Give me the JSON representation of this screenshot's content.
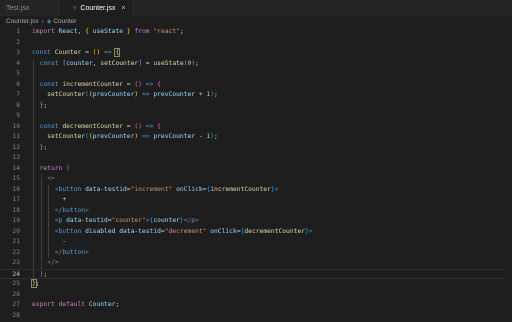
{
  "tabs": [
    {
      "label": "Test.jsx",
      "active": false
    },
    {
      "label": "Counter.jsx",
      "active": true
    }
  ],
  "breadcrumb": {
    "file": "Counter.jsx",
    "symbol": "Counter"
  },
  "current_line": 24,
  "code_lines": [
    [
      {
        "t": "import ",
        "c": "ctl"
      },
      {
        "t": "React",
        "c": "var"
      },
      {
        "t": ", ",
        "c": "plain"
      },
      {
        "t": "{",
        "c": "br1"
      },
      {
        "t": " useState ",
        "c": "var"
      },
      {
        "t": "}",
        "c": "br1"
      },
      {
        "t": " from ",
        "c": "ctl"
      },
      {
        "t": "\"react\"",
        "c": "str"
      },
      {
        "t": ";",
        "c": "plain"
      }
    ],
    [],
    [
      {
        "t": "const ",
        "c": "kw"
      },
      {
        "t": "Counter",
        "c": "fn"
      },
      {
        "t": " = ",
        "c": "op"
      },
      {
        "t": "()",
        "c": "br1"
      },
      {
        "t": " => ",
        "c": "kw"
      },
      {
        "t": "{",
        "c": "br1",
        "m": true
      }
    ],
    [
      {
        "t": "  const ",
        "c": "kw"
      },
      {
        "t": "[",
        "c": "br2"
      },
      {
        "t": "counter",
        "c": "var"
      },
      {
        "t": ", ",
        "c": "plain"
      },
      {
        "t": "setCounter",
        "c": "fn"
      },
      {
        "t": "]",
        "c": "br2"
      },
      {
        "t": " = ",
        "c": "op"
      },
      {
        "t": "useState",
        "c": "fn"
      },
      {
        "t": "(",
        "c": "br2"
      },
      {
        "t": "0",
        "c": "num"
      },
      {
        "t": ")",
        "c": "br2"
      },
      {
        "t": ";",
        "c": "plain"
      }
    ],
    [],
    [
      {
        "t": "  const ",
        "c": "kw"
      },
      {
        "t": "incrementCounter",
        "c": "fn"
      },
      {
        "t": " = ",
        "c": "op"
      },
      {
        "t": "()",
        "c": "br2"
      },
      {
        "t": " => ",
        "c": "kw"
      },
      {
        "t": "{",
        "c": "br2"
      }
    ],
    [
      {
        "t": "    setCounter",
        "c": "fn"
      },
      {
        "t": "(",
        "c": "br3"
      },
      {
        "t": "(",
        "c": "br1"
      },
      {
        "t": "prevCounter",
        "c": "var"
      },
      {
        "t": ")",
        "c": "br1"
      },
      {
        "t": " => ",
        "c": "kw"
      },
      {
        "t": "prevCounter",
        "c": "var"
      },
      {
        "t": " + ",
        "c": "op"
      },
      {
        "t": "1",
        "c": "num"
      },
      {
        "t": ")",
        "c": "br3"
      },
      {
        "t": ";",
        "c": "plain"
      }
    ],
    [
      {
        "t": "  ",
        "c": "plain"
      },
      {
        "t": "}",
        "c": "br2"
      },
      {
        "t": ";",
        "c": "plain"
      }
    ],
    [],
    [
      {
        "t": "  const ",
        "c": "kw"
      },
      {
        "t": "decrementCounter",
        "c": "fn"
      },
      {
        "t": " = ",
        "c": "op"
      },
      {
        "t": "()",
        "c": "br2"
      },
      {
        "t": " => ",
        "c": "kw"
      },
      {
        "t": "{",
        "c": "br2"
      }
    ],
    [
      {
        "t": "    setCounter",
        "c": "fn"
      },
      {
        "t": "(",
        "c": "br3"
      },
      {
        "t": "(",
        "c": "br1"
      },
      {
        "t": "prevCounter",
        "c": "var"
      },
      {
        "t": ")",
        "c": "br1"
      },
      {
        "t": " => ",
        "c": "kw"
      },
      {
        "t": "prevCounter",
        "c": "var"
      },
      {
        "t": " - ",
        "c": "op"
      },
      {
        "t": "1",
        "c": "num"
      },
      {
        "t": ")",
        "c": "br3"
      },
      {
        "t": ";",
        "c": "plain"
      }
    ],
    [
      {
        "t": "  ",
        "c": "plain"
      },
      {
        "t": "}",
        "c": "br2"
      },
      {
        "t": ";",
        "c": "plain"
      }
    ],
    [],
    [
      {
        "t": "  return ",
        "c": "ctl"
      },
      {
        "t": "(",
        "c": "br2"
      }
    ],
    [
      {
        "t": "    ",
        "c": "plain"
      },
      {
        "t": "<>",
        "c": "brk"
      }
    ],
    [
      {
        "t": "      ",
        "c": "plain"
      },
      {
        "t": "<",
        "c": "brk"
      },
      {
        "t": "button",
        "c": "tag"
      },
      {
        "t": " data-testid",
        "c": "attr"
      },
      {
        "t": "=",
        "c": "op"
      },
      {
        "t": "\"increment\"",
        "c": "str"
      },
      {
        "t": " onClick",
        "c": "attr"
      },
      {
        "t": "=",
        "c": "op"
      },
      {
        "t": "{",
        "c": "br3"
      },
      {
        "t": "incrementCounter",
        "c": "fn"
      },
      {
        "t": "}",
        "c": "br3"
      },
      {
        "t": ">",
        "c": "brk"
      }
    ],
    [
      {
        "t": "        +",
        "c": "plain"
      }
    ],
    [
      {
        "t": "      ",
        "c": "plain"
      },
      {
        "t": "</",
        "c": "brk"
      },
      {
        "t": "button",
        "c": "tag"
      },
      {
        "t": ">",
        "c": "brk"
      }
    ],
    [
      {
        "t": "      ",
        "c": "plain"
      },
      {
        "t": "<",
        "c": "brk"
      },
      {
        "t": "p",
        "c": "tag"
      },
      {
        "t": " data-testid",
        "c": "attr"
      },
      {
        "t": "=",
        "c": "op"
      },
      {
        "t": "\"counter\"",
        "c": "str"
      },
      {
        "t": ">",
        "c": "brk"
      },
      {
        "t": "{",
        "c": "br3"
      },
      {
        "t": "counter",
        "c": "var"
      },
      {
        "t": "}",
        "c": "br3"
      },
      {
        "t": "</",
        "c": "brk"
      },
      {
        "t": "p",
        "c": "tag"
      },
      {
        "t": ">",
        "c": "brk"
      }
    ],
    [
      {
        "t": "      ",
        "c": "plain"
      },
      {
        "t": "<",
        "c": "brk"
      },
      {
        "t": "button",
        "c": "tag"
      },
      {
        "t": " disabled",
        "c": "attr"
      },
      {
        "t": " data-testid",
        "c": "attr"
      },
      {
        "t": "=",
        "c": "op"
      },
      {
        "t": "\"decrement\"",
        "c": "str"
      },
      {
        "t": " onClick",
        "c": "attr"
      },
      {
        "t": "=",
        "c": "op"
      },
      {
        "t": "{",
        "c": "br3"
      },
      {
        "t": "decrementCounter",
        "c": "fn"
      },
      {
        "t": "}",
        "c": "br3"
      },
      {
        "t": ">",
        "c": "brk"
      }
    ],
    [
      {
        "t": "        -",
        "c": "plain"
      }
    ],
    [
      {
        "t": "      ",
        "c": "plain"
      },
      {
        "t": "</",
        "c": "brk"
      },
      {
        "t": "button",
        "c": "tag"
      },
      {
        "t": ">",
        "c": "brk"
      }
    ],
    [
      {
        "t": "    ",
        "c": "plain"
      },
      {
        "t": "</>",
        "c": "brk"
      }
    ],
    [
      {
        "t": "  ",
        "c": "plain"
      },
      {
        "t": ")",
        "c": "br2"
      },
      {
        "t": ";",
        "c": "plain"
      }
    ],
    [
      {
        "t": "}",
        "c": "br1",
        "m": true
      },
      {
        "t": ";",
        "c": "plain"
      }
    ],
    [],
    [
      {
        "t": "export ",
        "c": "ctl"
      },
      {
        "t": "default ",
        "c": "ctl"
      },
      {
        "t": "Counter",
        "c": "var"
      },
      {
        "t": ";",
        "c": "plain"
      }
    ],
    []
  ]
}
